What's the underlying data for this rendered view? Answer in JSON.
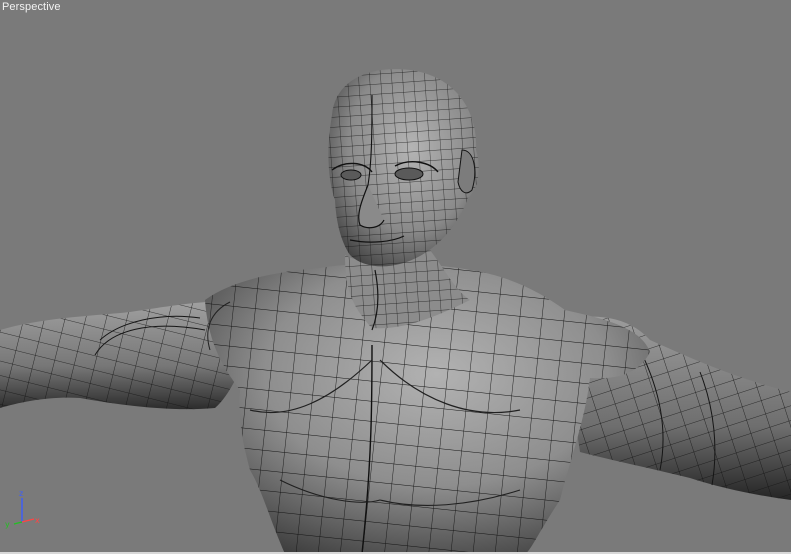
{
  "viewport": {
    "label": "Perspective",
    "render_mode": "smooth-shaded-with-wireframe-edges",
    "background_color": "#7a7a7a",
    "model_color": "#8a8a8a",
    "wire_color": "#111111"
  },
  "gizmo": {
    "x_label": "x",
    "y_label": "y",
    "z_label": "z",
    "x_color": "#ff4444",
    "y_color": "#22c022",
    "z_color": "#3a5cff"
  }
}
